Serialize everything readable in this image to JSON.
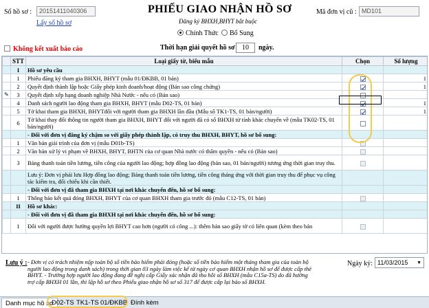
{
  "header": {
    "so_ho_so_label": "Số hồ sơ :",
    "so_ho_so_value": "20151411040306",
    "lay_so_link": "Lấy số hồ sơ",
    "title": "PHIẾU GIAO NHẬN HỒ SƠ",
    "subtitle": "Đăng ký BHXH,BHYT bắt buộc",
    "ma_don_vi_label": "Mã đơn vị cũ :",
    "ma_don_vi_value": "MD101",
    "option_1": "Chính Thức",
    "option_2": "Bổ Sung",
    "warning_checkbox_label": "Không kết xuất báo cáo",
    "deadline_label": "Thời hạn giải quyết hồ sơ :",
    "deadline_value": "10",
    "deadline_unit": "ngày."
  },
  "table": {
    "headers": {
      "stt": "STT",
      "loai": "Loại giấy tờ, biểu mẫu",
      "chon": "Chọn",
      "so_luong": "Số lượng"
    },
    "rows": [
      {
        "stt": "I",
        "text": "Hồ sơ yêu cầu",
        "kind": "sec"
      },
      {
        "stt": "1",
        "text": "Phiếu đăng ký tham gia BHXH, BHYT (mẫu 01/ĐKBB, 01 bản)",
        "checked": true,
        "qty": "1"
      },
      {
        "stt": "2",
        "text": "Quyết định thành lập hoặc Giấy phép kinh doanh/hoạt động (Bản sao công chứng)",
        "checked": true,
        "qty": "1"
      },
      {
        "stt": "3",
        "text": "Quyết định xếp hạng doanh nghiệp Nhà Nước - nếu có (Bản sao)",
        "checked": false,
        "qty": "",
        "edit": true
      },
      {
        "stt": "4",
        "text": "Danh sách người lao động tham gia BHXH, BHYT (mẫu D02-TS, 01 bản)",
        "checked": true,
        "qty": "1"
      },
      {
        "stt": "5",
        "text": "Tờ khai tham gia BHXH, BHYTđối với người tham gia BHXH lần đầu (Mẫu số TK1-TS, 01 bản/người)",
        "checked": true,
        "qty": "1"
      },
      {
        "stt": "6",
        "text": "Tờ khai thay đổi thông tin người tham gia BHXH, BHYT đối với người đã có số BHXH từ tỉnh khác chuyển về (mẫu TK02-TS, 01 bản/người)",
        "checked": false,
        "qty": "",
        "tall": true
      },
      {
        "stt": "",
        "text": "- Đối với đơn vị đăng ký chậm so với giấy phép thành lập, có truy thu BHXH, BHYT, hồ sơ bổ sung:",
        "kind": "sub"
      },
      {
        "stt": "1",
        "text": "Văn bản giải trình của đơn vị (mẫu D01b-TS)",
        "checked": false,
        "dis": true,
        "qty": ""
      },
      {
        "stt": "2",
        "text": "Văn bản xử lý vi phạm về BHXH, BHYT, BHTN của cơ quan Nhà nước có thẩm quyền - nếu có (Bản sao)",
        "checked": false,
        "dis": true,
        "qty": ""
      },
      {
        "stt": "3",
        "text": "Bảng thanh toán tiền lương, tiền công của người lao động; hợp đồng lao động (bản sao, 01 bản/người) tương ứng thời gian truy thu.",
        "checked": false,
        "dis": true,
        "qty": "",
        "tall": true
      },
      {
        "stt": "",
        "text": "Lưu ý: Đơn vị phải lưu Hợp đồng lao động; Bảng thanh toán tiền lương, tiền công tháng ứng với thời gian truy thu để phục vụ công tác kiểm tra, đối chiếu khi cần thiết.",
        "kind": "note",
        "tall": true
      },
      {
        "stt": "",
        "text": "- Đối với đơn vị đã tham gia BHXH tại nơi khác chuyển đến, hồ sơ bổ sung:",
        "kind": "sub"
      },
      {
        "stt": "1",
        "text": "Thông báo kết quả đóng BHXH, BHYT của cơ quan BHXH tham gia trước đó (mẫu C12-TS, 01 bản)",
        "checked": false,
        "dis": true,
        "qty": ""
      },
      {
        "stt": "II",
        "text": "Hồ sơ khác:",
        "kind": "sec"
      },
      {
        "stt": "",
        "text": "- Đối với đơn vị đã tham gia BHXH tại nơi khác chuyển đến, hồ sơ bổ sung:",
        "kind": "sub"
      },
      {
        "stt": "1",
        "text": "Đối với người được hưởng quyền lợi BHYT cao hơn (người có công ...): thêm bản sao giấy tờ có liên quan (kèm theo bản",
        "checked": false,
        "dis": true,
        "qty": "",
        "tall": true
      }
    ]
  },
  "footer": {
    "note_label": "Lưu ý :",
    "note_text": "- Đơn vị có trách nhiệm nộp toàn bộ số tiền bảo hiểm phải đóng (hoặc số tiền bảo hiểm một tháng tham gia của toàn bộ người lao động trong danh sách) trong thời gian 03 ngày làm việc kể từ ngày cơ quan BHXH nhận hồ sơ để được cấp thẻ BHYT. - Trường hợp người lao động đang đề nghị cấp Giấy xác nhận đã thu hồi sổ BHXH (mẫu C15a-TS) do đã hưởng trợ cấp BHXH 01 lần, thì lập hồ sơ theo Phiếu giao nhận hồ sơ số 317 để được cấp lại bảo sổ BHXH.",
    "date_label": "Ngày ký:",
    "date_value": "11/03/2015"
  },
  "tabs": [
    "Danh mục hồ sơ",
    "D02-TS",
    "TK1-TS",
    "01/ĐKBB",
    "Đính kèm"
  ]
}
